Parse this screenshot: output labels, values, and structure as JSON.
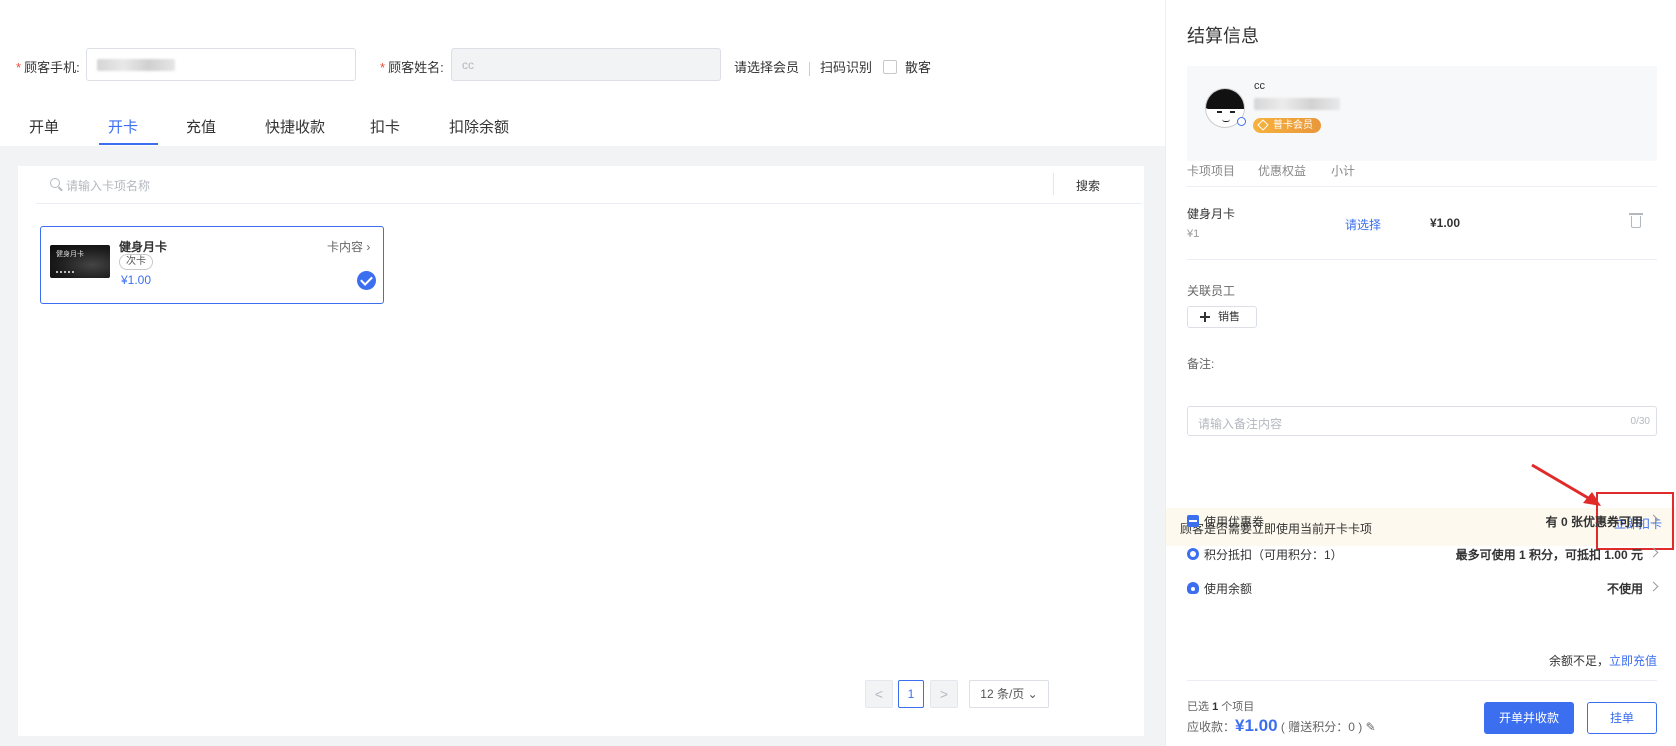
{
  "form": {
    "phone_label": "顾客手机:",
    "name_label": "顾客姓名:",
    "name_value": "cc",
    "select_member": "请选择会员",
    "scan": "扫码识别",
    "walk_in": "散客"
  },
  "tabs": [
    {
      "label": "开单"
    },
    {
      "label": "开卡"
    },
    {
      "label": "充值"
    },
    {
      "label": "快捷收款"
    },
    {
      "label": "扣卡"
    },
    {
      "label": "扣除余额"
    }
  ],
  "search": {
    "placeholder": "请输入卡项名称",
    "button": "搜索"
  },
  "card": {
    "thumb_text": "健身月卡",
    "name": "健身月卡",
    "tag": "次卡",
    "price": "¥1.00",
    "detail_link": "卡内容"
  },
  "pager": {
    "prev": "<",
    "current": "1",
    "next": ">",
    "page_size": "12 条/页"
  },
  "settlement": {
    "title": "结算信息",
    "member": {
      "name": "cc",
      "badge": "普卡会员"
    },
    "table_headers": {
      "item": "卡项项目",
      "discount": "优惠权益",
      "subtotal": "小计"
    },
    "item": {
      "name": "健身月卡",
      "price": "¥1",
      "discount_link": "请选择",
      "subtotal": "¥1.00"
    },
    "staff_label": "关联员工",
    "staff_button": "销售",
    "note_label": "备注:",
    "note_placeholder": "请输入备注内容",
    "note_count": "0/30",
    "notice_text": "顾客是否需要立即使用当前开卡卡项",
    "notice_link": "立即扣卡",
    "options": [
      {
        "label": "使用优惠券",
        "value": "有 0 张优惠券可用"
      },
      {
        "label": "积分抵扣（可用积分：1）",
        "value": "最多可使用 1 积分，可抵扣 1.00 元"
      },
      {
        "label": "使用余额",
        "value": "不使用"
      }
    ],
    "insufficient_text": "余额不足，",
    "recharge_link": "立即充值",
    "selected_prefix": "已选",
    "selected_count": "1",
    "selected_suffix": "个项目",
    "due_label": "应收款：",
    "due_amount": "¥1.00",
    "bonus_points": "( 赠送积分：0 )",
    "primary_button": "开单并收款",
    "secondary_button": "挂单"
  },
  "colors": {
    "accent": "#3c6ff0",
    "required": "#e74c3c",
    "highlight_box": "#e12b2b",
    "badge": "#f0a63a"
  }
}
